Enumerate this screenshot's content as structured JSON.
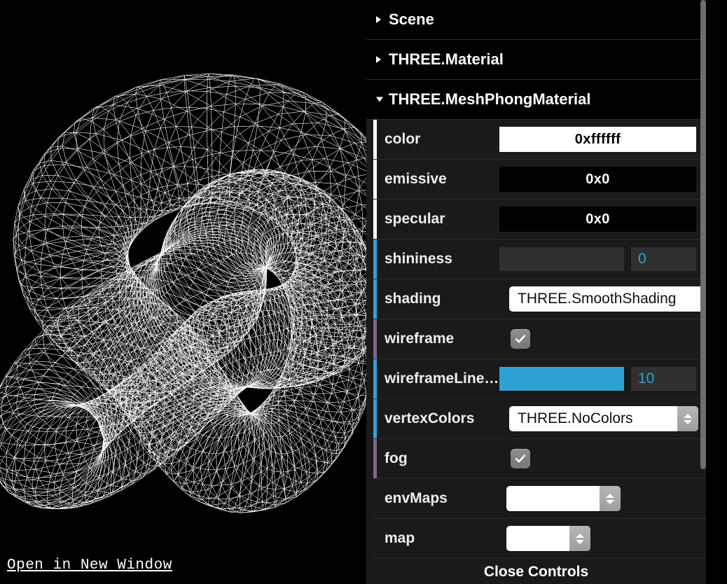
{
  "page": {
    "open_link": "Open in New Window",
    "close_controls": "Close Controls"
  },
  "gui": {
    "folders": [
      {
        "label": "Scene",
        "open": false
      },
      {
        "label": "THREE.Material",
        "open": false
      },
      {
        "label": "THREE.MeshPhongMaterial",
        "open": true
      }
    ],
    "rows": [
      {
        "label": "color",
        "type": "color",
        "value": "0xffffff",
        "swatch_bg": "#ffffff",
        "text_color": "#000000",
        "stripe": "#ffffff"
      },
      {
        "label": "emissive",
        "type": "color",
        "value": "0x0",
        "swatch_bg": "#000000",
        "text_color": "#ffffff",
        "stripe": "#ffffff"
      },
      {
        "label": "specular",
        "type": "color",
        "value": "0x0",
        "swatch_bg": "#000000",
        "text_color": "#ffffff",
        "stripe": "#ffffff"
      },
      {
        "label": "shininess",
        "type": "slider",
        "value": "0",
        "fill_pct": 0,
        "stripe": "#2fa1d6"
      },
      {
        "label": "shading",
        "type": "select",
        "value": "THREE.SmoothShading",
        "stripe": "#2fa1d6"
      },
      {
        "label": "wireframe",
        "type": "checkbox",
        "checked": true,
        "stripe": "#806787"
      },
      {
        "label": "wireframeLine…",
        "type": "slider",
        "value": "10",
        "fill_pct": 100,
        "stripe": "#2fa1d6"
      },
      {
        "label": "vertexColors",
        "type": "select",
        "value": "THREE.NoColors",
        "stripe": "#2fa1d6"
      },
      {
        "label": "fog",
        "type": "checkbox",
        "checked": true,
        "stripe": "#806787"
      },
      {
        "label": "envMaps",
        "type": "select",
        "value": "",
        "stripe": "none"
      },
      {
        "label": "map",
        "type": "select",
        "value": "",
        "stripe": "none"
      }
    ]
  },
  "colors": {
    "accent_blue": "#2fa1d6",
    "boolean_purple": "#806787",
    "panel_bg": "#1a1a1a",
    "folder_bg": "#000000",
    "scrollbar": "#6e6e6e"
  }
}
